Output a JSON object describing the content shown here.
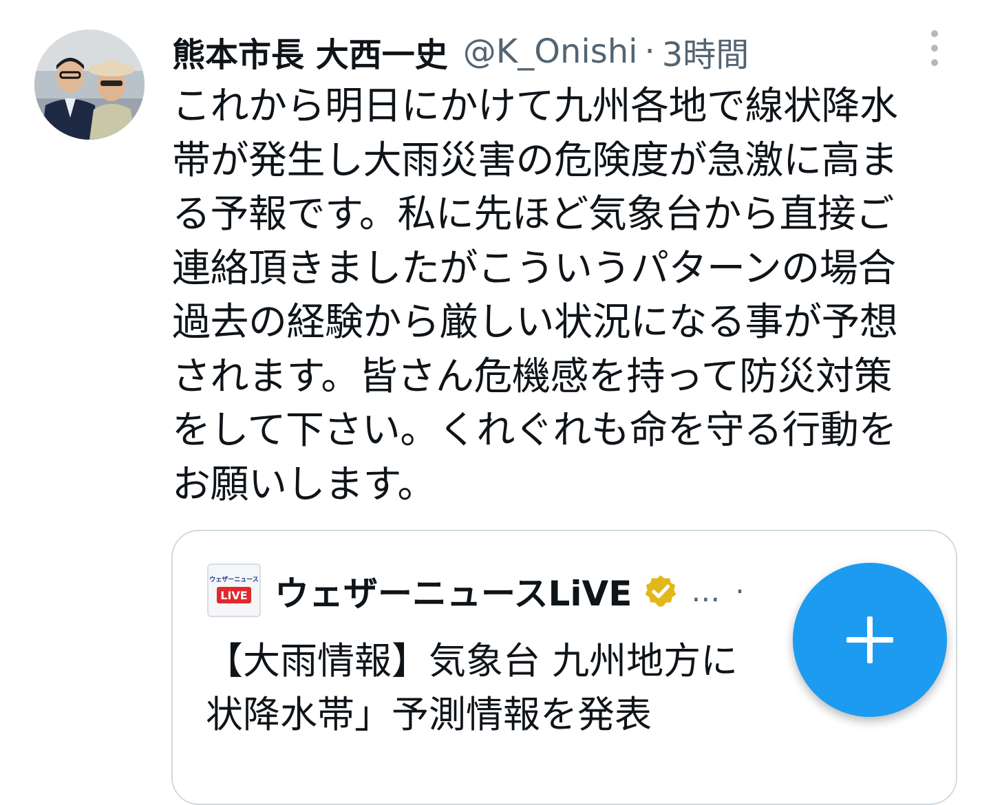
{
  "tweet": {
    "author_name": "熊本市長 大西一史",
    "handle": "@K_Onishi",
    "separator": "·",
    "time": "3時間",
    "text_lines": [
      "これから明日にかけて九州各地で線状降水",
      "帯が発生し大雨災害の危険度が急激に高ま",
      "る予報です。私に先ほど気象台から直接ご",
      "連絡頂きましたがこういうパターンの場合",
      "過去の経験から厳しい状況になる事が予想",
      "されます。皆さん危機感を持って防災対策",
      "をして下さい。くれぐれも命を守る行動を",
      "お願いします。"
    ]
  },
  "quoted_tweet": {
    "logo_top_text": "ウェザーニュース",
    "logo_badge_text": "LIVE",
    "author_name": "ウェザーニュースLiVE",
    "ellipsis": "…",
    "separator": "·",
    "text_lines": [
      "【大雨情報】気象台 九州地方に",
      "状降水帯」予測情報を発表"
    ]
  },
  "colors": {
    "primary_text": "#0f1419",
    "secondary_text": "#536471",
    "fab_blue": "#1d9bf0",
    "verified_gold": "#e2b719",
    "card_border": "#cfd9de"
  },
  "icons": {
    "more": "more-vertical-icon",
    "verified": "verified-badge-icon",
    "compose": "plus-icon"
  }
}
